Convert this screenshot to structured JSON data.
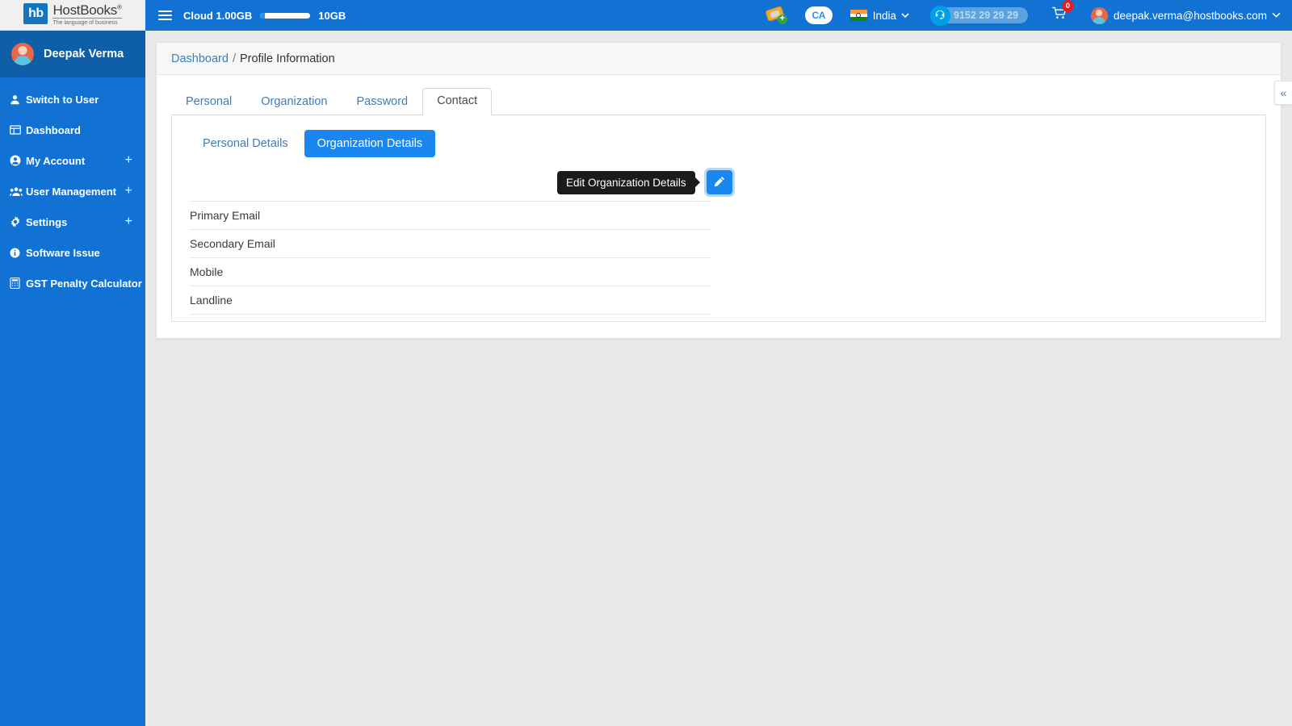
{
  "brand": {
    "mark": "hb",
    "name": "HostBooks",
    "registered": "®",
    "tagline": "The language of business"
  },
  "sidebar": {
    "profile_name": "Deepak Verma",
    "items": [
      {
        "label": "Switch to User",
        "icon": "user-icon",
        "glyph": "♟",
        "expandable": false
      },
      {
        "label": "Dashboard",
        "icon": "dashboard-icon",
        "glyph": "▤",
        "expandable": false
      },
      {
        "label": "My Account",
        "icon": "account-circle-icon",
        "glyph": "ⓘ",
        "expandable": true,
        "plus": "+"
      },
      {
        "label": "User Management",
        "icon": "users-group-icon",
        "glyph": "♟",
        "expandable": true,
        "plus": "+"
      },
      {
        "label": "Settings",
        "icon": "gear-icon",
        "glyph": "⚙",
        "expandable": true,
        "plus": "+"
      },
      {
        "label": "Software Issue",
        "icon": "info-circle-icon",
        "glyph": "ℹ",
        "expandable": false
      },
      {
        "label": "GST Penalty Calculator",
        "icon": "calculator-icon",
        "glyph": "▦",
        "expandable": false
      }
    ]
  },
  "topbar": {
    "menu_toggle_name": "hamburger-menu",
    "cloud_label": "Cloud 1.00GB",
    "cloud_used_percent": 10,
    "cloud_max": "10GB",
    "ticket_icon_name": "add-ticket-icon",
    "ca_badge": "CA",
    "country": "India",
    "country_chevron": "⌄",
    "support_icon": "☎",
    "support_number": "9152 29 29 29",
    "cart_glyph": "Ὥ2",
    "cart_count": "0",
    "user_email": "deepak.verma@hostbooks.com",
    "user_chevron": "⌄"
  },
  "breadcrumb": {
    "root": "Dashboard",
    "separator": "/",
    "current": "Profile Information"
  },
  "tabs": [
    {
      "label": "Personal",
      "active": false
    },
    {
      "label": "Organization",
      "active": false
    },
    {
      "label": "Password",
      "active": false
    },
    {
      "label": "Contact",
      "active": true
    }
  ],
  "subtabs": [
    {
      "label": "Personal Details",
      "active": false
    },
    {
      "label": "Organization Details",
      "active": true
    }
  ],
  "tooltip": {
    "text": "Edit Organization Details"
  },
  "edit_button": {
    "icon": "pencil-icon"
  },
  "fields": [
    {
      "label": "Primary Email",
      "value": ""
    },
    {
      "label": "Secondary Email",
      "value": ""
    },
    {
      "label": "Mobile",
      "value": ""
    },
    {
      "label": "Landline",
      "value": ""
    }
  ],
  "collapse_handle": {
    "icon": "chevron-double-left-icon",
    "glyph": "«"
  },
  "colors": {
    "brand_blue": "#1272d4",
    "sidebar_profile_blue": "#0e5ea8",
    "accent_blue": "#1a86f0",
    "link_blue": "#3b7dbd",
    "badge_red": "#e02020",
    "page_bg": "#e9e9e9",
    "tooltip_bg": "#1b1b1b"
  }
}
